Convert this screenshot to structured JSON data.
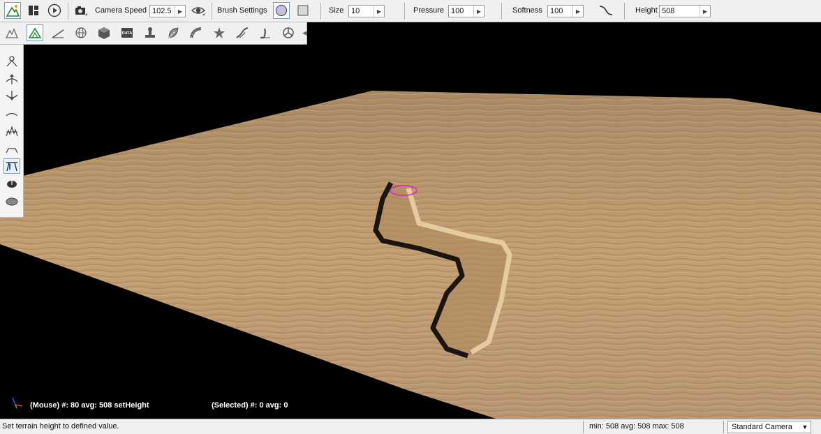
{
  "toolbar": {
    "camera_speed_label": "Camera Speed",
    "camera_speed_value": "102.5",
    "brush_settings_label": "Brush Settings",
    "size_label": "Size",
    "size_value": "10",
    "pressure_label": "Pressure",
    "pressure_value": "100",
    "softness_label": "Softness",
    "softness_value": "100",
    "height_label": "Height",
    "height_value": "508"
  },
  "secondary_toolbar": {
    "icons": [
      "terrain-mountains-icon",
      "terrain-edit-icon",
      "ruler-icon",
      "globe-icon",
      "cube-icon",
      "data-icon",
      "stamp-icon",
      "leaf-icon",
      "road-icon",
      "star-icon",
      "river-icon",
      "path-icon",
      "gizmo-icon"
    ],
    "data_badge": "DATA"
  },
  "sidebar": {
    "tools": [
      "raise-lower-icon",
      "raise-icon",
      "lower-icon",
      "smooth-icon",
      "noise-icon",
      "flatten-icon",
      "set-height-icon",
      "hole-icon",
      "erase-icon"
    ],
    "active_index": 6
  },
  "viewport_overlay": {
    "mouse_info": "(Mouse) #: 80  avg: 508 setHeight",
    "selected_info": "(Selected) #: 0  avg: 0"
  },
  "status": {
    "message": "Set terrain height to defined value.",
    "stats": "min: 508  avg: 508  max: 508",
    "camera": "Standard Camera"
  },
  "colors": {
    "sand": "#c39f72",
    "sky": "#000000",
    "brush_ring": "#e020c0",
    "toolbar_bg": "#f0f0f0"
  }
}
